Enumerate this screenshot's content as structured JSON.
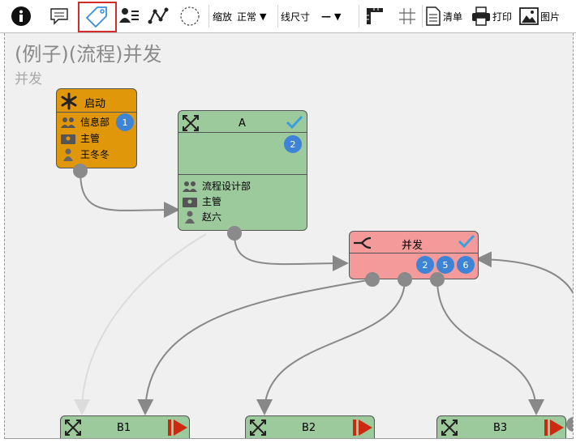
{
  "toolbar": {
    "zoom_label": "缩放",
    "zoom_value": "正常",
    "line_size_label": "线尺寸",
    "line_size_value": "—",
    "list_label": "清单",
    "print_label": "打印",
    "image_label": "图片"
  },
  "diagram": {
    "title": "(例子)(流程)并发",
    "subtitle": "并发"
  },
  "nodes": {
    "start": {
      "title": "启动",
      "dept": "信息部",
      "role": "主管",
      "person": "王冬冬",
      "badge": "1"
    },
    "a": {
      "title": "A",
      "badge": "2",
      "dept": "流程设计部",
      "role": "主管",
      "person": "赵六"
    },
    "concurrent": {
      "title": "并发",
      "badges": [
        "2",
        "5",
        "6"
      ]
    },
    "b1": {
      "title": "B1"
    },
    "b2": {
      "title": "B2"
    },
    "b3": {
      "title": "B3"
    }
  },
  "colors": {
    "start_fill": "#e0980a",
    "task_fill": "#9cca9c",
    "concurrent_fill": "#f59a9a",
    "badge": "#3d84d6",
    "check": "#3aa0dc",
    "play": "#cc2a10",
    "connector": "#888888"
  },
  "icons": [
    "info-icon",
    "comment-icon",
    "tag-icon",
    "users-list-icon",
    "polyline-icon",
    "circle-icon",
    "ruler-icon",
    "grid-icon",
    "document-icon",
    "printer-icon",
    "picture-icon"
  ]
}
